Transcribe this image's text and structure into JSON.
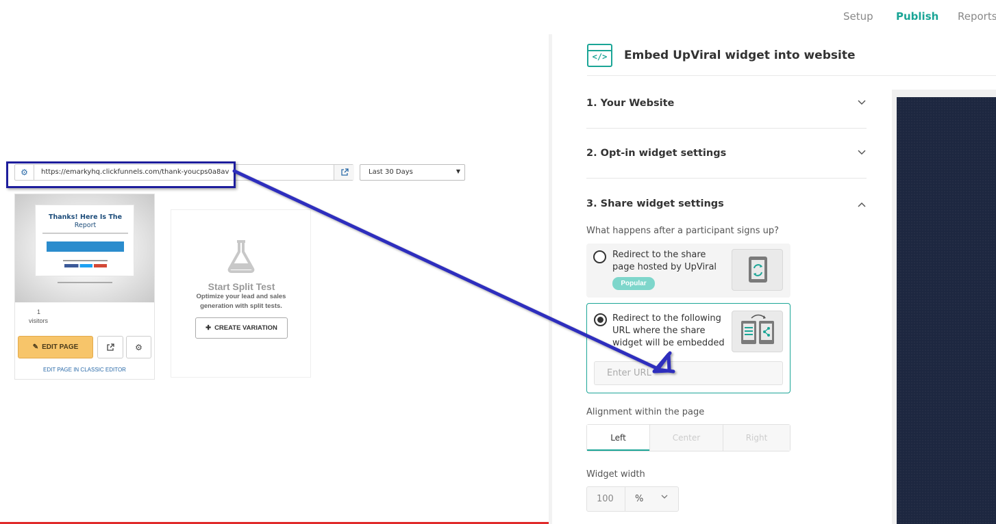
{
  "clickfunnels": {
    "url": "https://emarkyhq.clickfunnels.com/thank-youcps0a8av",
    "date_range": "Last 30 Days",
    "page_card": {
      "thumbnail_title_line1": "Thanks! Here Is The",
      "thumbnail_title_line2": "Report",
      "visitors_count": "1",
      "visitors_label": "visitors",
      "edit_page_label": "EDIT PAGE",
      "classic_editor_link": "EDIT PAGE IN CLASSIC EDITOR"
    },
    "split_test": {
      "title": "Start Split Test",
      "description": "Optimize your lead and sales generation with split tests.",
      "create_variation_label": "CREATE VARIATION"
    }
  },
  "upviral": {
    "nav": {
      "setup": "Setup",
      "publish": "Publish",
      "reports": "Reports",
      "active": "Publish"
    },
    "header_title": "Embed UpViral widget into website",
    "sections": [
      {
        "label": "1. Your Website",
        "expanded": false
      },
      {
        "label": "2. Opt-in widget settings",
        "expanded": false
      },
      {
        "label": "3. Share widget settings",
        "expanded": true
      }
    ],
    "share_settings": {
      "question": "What happens after a participant signs up?",
      "option1_line1": "Redirect to the share",
      "option1_line2": "page hosted by UpViral",
      "option1_badge": "Popular",
      "option2_line1": "Redirect to the following",
      "option2_line2": "URL where the share",
      "option2_line3": "widget will be embedded",
      "selected_option": 2,
      "url_placeholder": "Enter URL",
      "alignment_label": "Alignment within the page",
      "alignment_options": [
        "Left",
        "Center",
        "Right"
      ],
      "alignment_selected": "Left",
      "width_label": "Widget width",
      "width_value": "100",
      "width_unit": "%"
    }
  },
  "colors": {
    "accent": "#1aa596",
    "annotation": "#1d1d9c",
    "edit_button": "#f7c56a",
    "preview_bg": "#1d2740"
  }
}
